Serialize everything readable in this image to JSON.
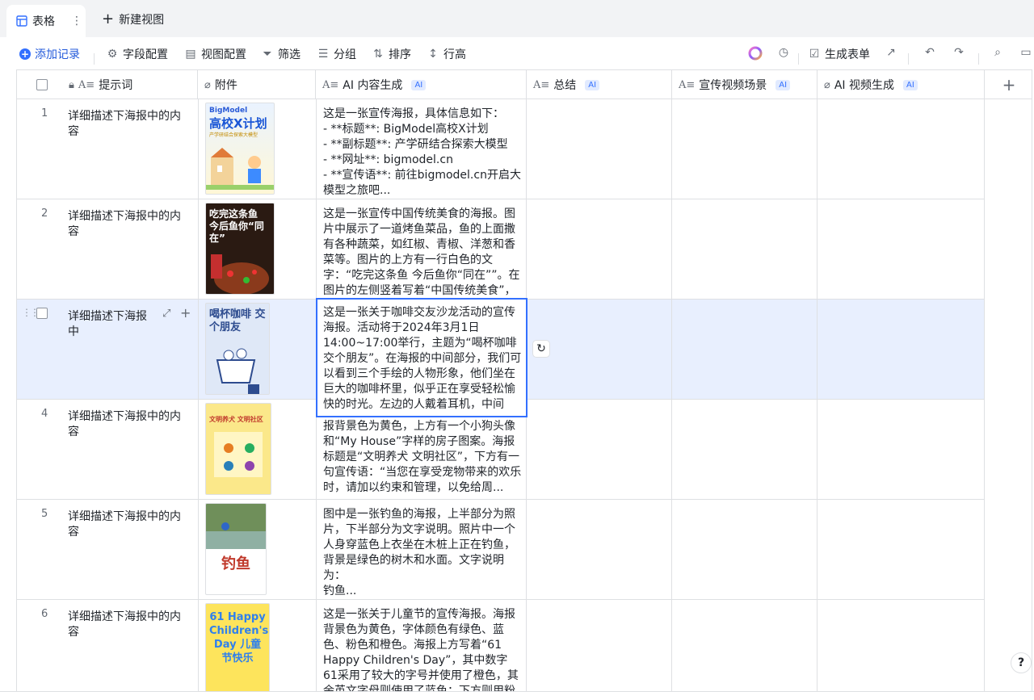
{
  "tabs": {
    "active_label": "表格",
    "more": "⋮",
    "new_view": "新建视图"
  },
  "toolbar": {
    "add_record": "添加记录",
    "field_config": "字段配置",
    "view_config": "视图配置",
    "filter": "筛选",
    "group": "分组",
    "sort": "排序",
    "row_height": "行高",
    "generate_form": "生成表单"
  },
  "columns": [
    {
      "name": "提示词",
      "ai": ""
    },
    {
      "name": "附件",
      "ai": ""
    },
    {
      "name": "AI 内容生成",
      "ai": "AI"
    },
    {
      "name": "总结",
      "ai": "AI"
    },
    {
      "name": "宣传视频场景",
      "ai": "AI"
    },
    {
      "name": "AI 视频生成",
      "ai": "AI"
    }
  ],
  "rows": [
    {
      "num": "1",
      "prompt": "详细描述下海报中的内容",
      "text": "这是一张宣传海报，具体信息如下：\n- **标题**: BigModel高校X计划\n- **副标题**: 产学研结合探索大模型\n- **网址**: bigmodel.cn\n- **宣传语**: 前往bigmodel.cn开启大模型之旅吧...",
      "thumb": {
        "top": "BigModel",
        "title": "高校X计划",
        "sub": "产学研结合探索大模型"
      }
    },
    {
      "num": "2",
      "prompt": "详细描述下海报中的内容",
      "text": "这是一张宣传中国传统美食的海报。图片中展示了一道烤鱼菜品，鱼的上面撒有各种蔬菜，如红椒、青椒、洋葱和香菜等。图片的上方有一行白色的文字：“吃完这条鱼 今后鱼你“同在””。在图片的左侧竖着写着“中国传统美食”，右...",
      "thumb": {
        "title": "吃完这条鱼 今后鱼你“同在”"
      }
    },
    {
      "num": "",
      "prompt": "详细描述下海报中",
      "text": "这是一张关于咖啡交友沙龙活动的宣传海报。活动将于2024年3月1日14:00~17:00举行，主题为“喝杯咖啡交个朋友”。在海报的中间部分，我们可以看到三个手绘的人物形象，他们坐在巨大的咖啡杯里，似乎正在享受轻松愉快的时光。左边的人戴着耳机，中间",
      "thumb": {
        "title": "喝杯咖啡 交个朋友"
      }
    },
    {
      "num": "4",
      "prompt": "详细描述下海报中的内容",
      "text": "报背景色为黄色，上方有一个小狗头像和“My House”字样的房子图案。海报标题是“文明养犬 文明社区”，下方有一句宣传语：“当您在享受宠物带来的欢乐时，请加以约束和管理，以免给周...",
      "thumb": {
        "title": "文明养犬 文明社区"
      }
    },
    {
      "num": "5",
      "prompt": "详细描述下海报中的内容",
      "text": "图中是一张钓鱼的海报，上半部分为照片，下半部分为文字说明。照片中一个人身穿蓝色上衣坐在木桩上正在钓鱼，背景是绿色的树木和水面。文字说明为：\n钓鱼...",
      "thumb": {
        "title": "钓鱼"
      }
    },
    {
      "num": "6",
      "prompt": "详细描述下海报中的内容",
      "text": "这是一张关于儿童节的宣传海报。海报背景色为黄色，字体颜色有绿色、蓝色、粉色和橙色。海报上方写着“61 Happy Children's Day”，其中数字61采用了较大的字号并使用了橙色，其余英文字母则使用了蓝色；下方则用粉",
      "thumb": {
        "title": "61 Happy Children's Day 儿童节快乐"
      }
    }
  ],
  "colors": {
    "accent": "#3370ff",
    "selected_row": "#e8effe",
    "ai_tag_bg": "#e1eaff"
  }
}
